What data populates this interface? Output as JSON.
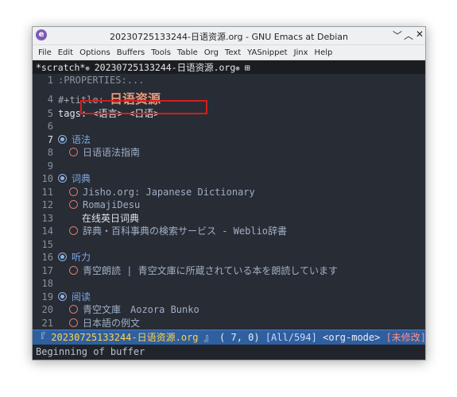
{
  "window": {
    "title": "20230725133244-日语资源.org - GNU Emacs at Debian",
    "app_icon": "emacs-icon",
    "controls": {
      "minimize": "﹀",
      "maximize": "︿",
      "close": "✕"
    }
  },
  "menu": [
    "File",
    "Edit",
    "Options",
    "Buffers",
    "Tools",
    "Table",
    "Org",
    "Text",
    "YASnippet",
    "Jinx",
    "Help"
  ],
  "tabs": [
    {
      "label": "*scratch*",
      "close": "⊗"
    },
    {
      "label": "20230725133244-日语资源.org",
      "close": "⊗"
    },
    {
      "label": "⊞"
    }
  ],
  "lines": {
    "l1": {
      "num": "1",
      "text": ":PROPERTIES:..."
    },
    "l4": {
      "num": "4",
      "key": "#+title:",
      "value": "日语资源"
    },
    "l5": {
      "num": "5",
      "text": "tags: <语言> <日语>"
    },
    "l6": {
      "num": "6"
    },
    "l7": {
      "num": "7",
      "text": "语法"
    },
    "l8": {
      "num": "8",
      "text": "日语语法指南"
    },
    "l9": {
      "num": "9"
    },
    "l10": {
      "num": "10",
      "text": "词典"
    },
    "l11": {
      "num": "11",
      "text": "Jisho.org: Japanese Dictionary"
    },
    "l12": {
      "num": "12",
      "text": "RomajiDesu"
    },
    "l13": {
      "num": "13",
      "text": "在线英日词典"
    },
    "l14": {
      "num": "14",
      "text": "辞典・百科事典の検索サービス - Weblio辞書"
    },
    "l15": {
      "num": "15"
    },
    "l16": {
      "num": "16",
      "text": "听力"
    },
    "l17": {
      "num": "17",
      "text": "青空朗読 | 青空文庫に所蔵されている本を朗読しています"
    },
    "l18": {
      "num": "18"
    },
    "l19": {
      "num": "19",
      "text": "阅读"
    },
    "l20": {
      "num": "20",
      "text": "青空文庫　Aozora Bunko"
    },
    "l21": {
      "num": "21",
      "text": "日本語の例文"
    }
  },
  "modeline": {
    "open": "『",
    "buffer": "20230725133244-日语资源.org",
    "close": "』",
    "position": "( 7, 0)",
    "scroll": "[All/594]",
    "mode": "<org-mode>",
    "status": "[未修改]"
  },
  "echo": "Beginning of buffer",
  "colors": {
    "background": "#282c34",
    "modeline": "#2f5f9e",
    "highlight_box": "#d81c1c",
    "title": "#e5997d"
  }
}
